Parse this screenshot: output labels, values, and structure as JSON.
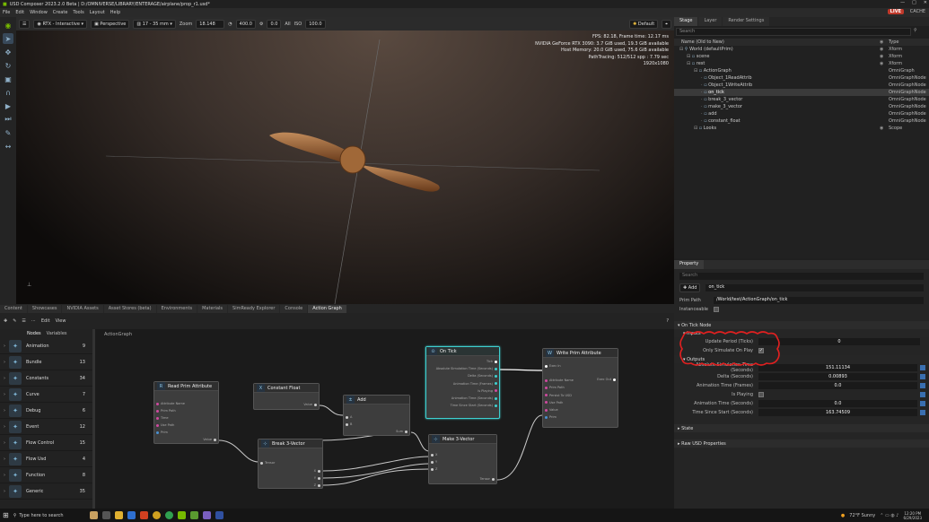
{
  "titlebar": {
    "title": "USD Composer   2023.2.0 Beta | D:/OMNIVERSE/LIBRARY/ENTERAGE/airplane/prop_r1.usd*"
  },
  "menu": [
    "File",
    "Edit",
    "Window",
    "Create",
    "Tools",
    "Layout",
    "Help"
  ],
  "badges": {
    "live": "LIVE",
    "cache": "CACHE"
  },
  "viewport_toolbar": {
    "renderer": "RTX - Interactive",
    "camera": "Perspective",
    "lens": "17 - 35 mm",
    "zoom_label": "Zoom",
    "zoom_value": "18.148",
    "v1": "400.0",
    "v2": "0.0",
    "iso_label": "ISO",
    "iso_value": "100.0",
    "all_label": "All",
    "preset": "Default"
  },
  "stats": [
    "FPS: 82.18, Frame time: 12.17 ms",
    "NVIDIA GeForce RTX 3090: 3.7 GiB used, 19.3 GiB available",
    "Host Memory: 20.0 GiB used, 75.6 GiB available",
    "PathTracing: 512/512 spp : 7.79 sec",
    "1920x1080"
  ],
  "bottom_tabs": [
    "Content",
    "Showcases",
    "NVIDIA Assets",
    "Asset Stores (beta)",
    "Environments",
    "Materials",
    "SimReady Explorer",
    "Console",
    "Action Graph"
  ],
  "ag_toolbar": {
    "edit": "Edit",
    "view": "View"
  },
  "nodelist": {
    "tab_nodes": "Nodes",
    "tab_variables": "Variables",
    "categories": [
      {
        "name": "Animation",
        "count": "9",
        "icon": "animation-icon"
      },
      {
        "name": "Bundle",
        "count": "13",
        "icon": "bundle-icon"
      },
      {
        "name": "Constants",
        "count": "34",
        "icon": "constants-icon"
      },
      {
        "name": "Curve",
        "count": "7",
        "icon": "curve-icon"
      },
      {
        "name": "Debug",
        "count": "6",
        "icon": "debug-icon"
      },
      {
        "name": "Event",
        "count": "12",
        "icon": "event-icon"
      },
      {
        "name": "Flow Control",
        "count": "15",
        "icon": "flow-control-icon"
      },
      {
        "name": "Flow Usd",
        "count": "4",
        "icon": "flow-usd-icon"
      },
      {
        "name": "Function",
        "count": "8",
        "icon": "function-icon"
      },
      {
        "name": "Generic",
        "count": "35",
        "icon": "generic-icon"
      }
    ]
  },
  "canvas": {
    "breadcrumb": "ActionGraph"
  },
  "nodes": {
    "read": {
      "title": "Read Prim Attribute",
      "pins": [
        "Attribute Name",
        "Prim Path",
        "Time",
        "Use Path",
        "Prim"
      ],
      "out": "Value"
    },
    "constant": {
      "title": "Constant Float",
      "out": "Value"
    },
    "add": {
      "title": "Add",
      "pins": [
        "A",
        "B"
      ],
      "out": "Sum"
    },
    "ontick": {
      "title": "On Tick",
      "out": [
        "Tick",
        "Absolute Simulation Time (Seconds)",
        "Delta (Seconds)",
        "Animation Time (Frames)",
        "Is Playing",
        "Animation Time (Seconds)",
        "Time Since Start (Seconds)"
      ]
    },
    "write": {
      "title": "Write Prim Attribute",
      "in": [
        "Exec In",
        "Attribute Name",
        "Prim Path",
        "Persist To USD",
        "Use Path",
        "Value",
        "Prim"
      ],
      "out": "Exec Out"
    },
    "break": {
      "title": "Break 3-Vector",
      "in": "Tensor",
      "out": [
        "X",
        "Y",
        "Z"
      ]
    },
    "make": {
      "title": "Make 3-Vector",
      "in": [
        "X",
        "Y",
        "Z"
      ],
      "out": "Tensor"
    }
  },
  "stage": {
    "tabs": [
      "Stage",
      "Layer",
      "Render Settings"
    ],
    "search_placeholder": "Search",
    "col_name": "Name (Old to New)",
    "col_type": "Type",
    "rows": [
      {
        "name": "World (defaultPrim)",
        "type": "Xform",
        "indent": 0
      },
      {
        "name": "scene",
        "type": "Xform",
        "indent": 1
      },
      {
        "name": "rest",
        "type": "Xform",
        "indent": 1
      },
      {
        "name": "ActionGraph",
        "type": "OmniGraph",
        "indent": 2
      },
      {
        "name": "Object_1ReadAttrib",
        "type": "OmniGraphNode",
        "indent": 3
      },
      {
        "name": "Object_1WriteAttrib",
        "type": "OmniGraphNode",
        "indent": 3
      },
      {
        "name": "on_tick",
        "type": "OmniGraphNode",
        "indent": 3,
        "selected": true
      },
      {
        "name": "break_3_vector",
        "type": "OmniGraphNode",
        "indent": 3
      },
      {
        "name": "make_3_vector",
        "type": "OmniGraphNode",
        "indent": 3
      },
      {
        "name": "add",
        "type": "OmniGraphNode",
        "indent": 3
      },
      {
        "name": "constant_float",
        "type": "OmniGraphNode",
        "indent": 3
      },
      {
        "name": "Looks",
        "type": "Scope",
        "indent": 2
      }
    ]
  },
  "property": {
    "tab": "Property",
    "search_placeholder": "Search",
    "add": "Add",
    "name_value": "on_tick",
    "prim_path_label": "Prim Path",
    "prim_path": "/World/test/ActionGraph/on_tick",
    "instanceable_label": "Instanceable",
    "section": "On Tick Node",
    "inputs": "Inputs",
    "update_label": "Update Period (Ticks)",
    "update_value": "0",
    "only_sim_label": "Only Simulate On Play",
    "outputs": "Outputs",
    "outs": [
      {
        "label": "Absolute Simulation Time (Seconds)",
        "value": "151.11134"
      },
      {
        "label": "Delta (Seconds)",
        "value": "0.00893"
      },
      {
        "label": "Animation Time (Frames)",
        "value": "0.0"
      },
      {
        "label": "Is Playing",
        "value": ""
      },
      {
        "label": "Animation Time (Seconds)",
        "value": "0.0"
      },
      {
        "label": "Time Since Start (Seconds)",
        "value": "163.74509"
      }
    ],
    "state": "State",
    "raw": "Raw USD Properties"
  },
  "taskbar": {
    "search": "Type here to search",
    "weather": "72°F  Sunny",
    "time": "12:20 PM",
    "date": "6/29/2023"
  },
  "colors": {
    "accent": "#76b900",
    "highlight": "#e02020",
    "ontick_border": "#3fd0d0"
  }
}
